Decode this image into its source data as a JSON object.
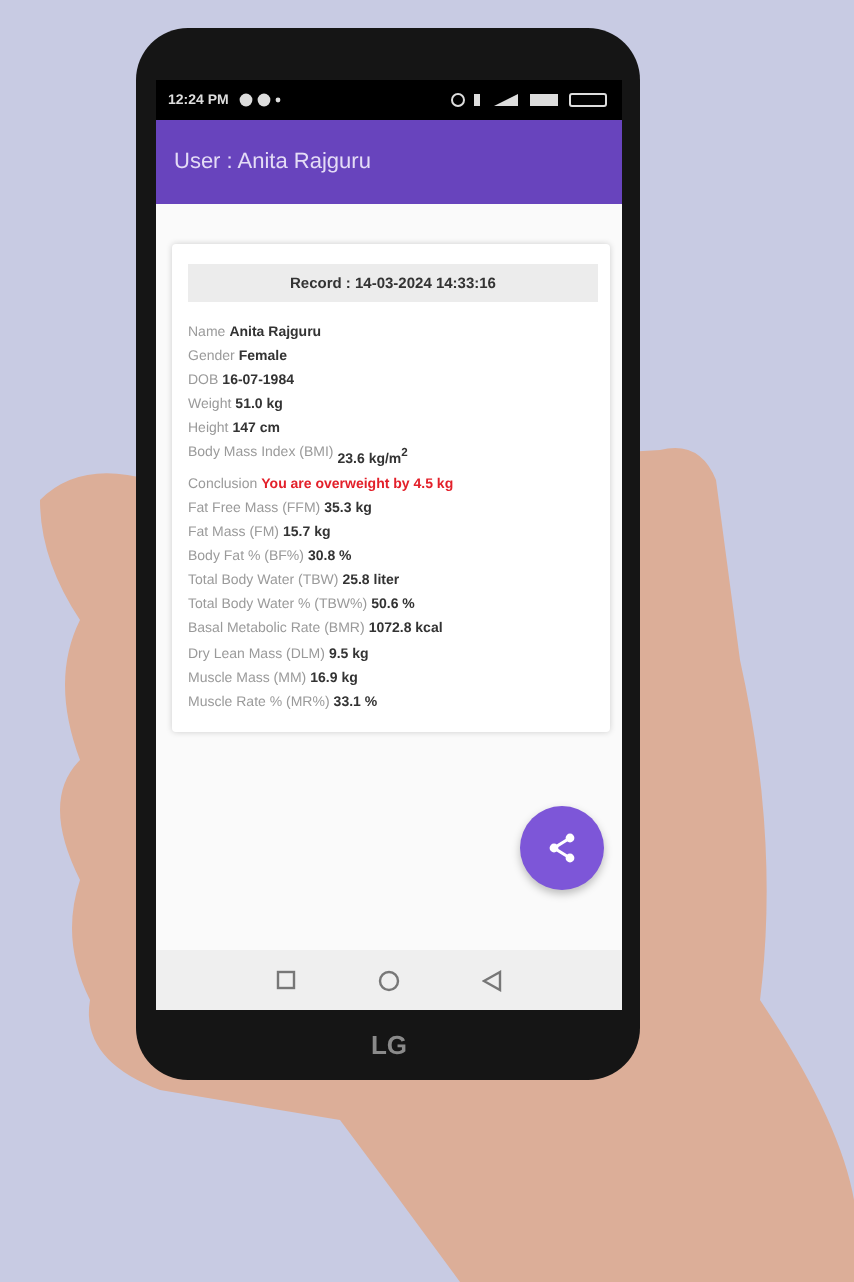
{
  "status_bar": {
    "time": "12:24 PM"
  },
  "app_bar": {
    "title": "User : Anita Rajguru"
  },
  "record": {
    "header": "Record : 14-03-2024 14:33:16",
    "rows": [
      {
        "label": "Name",
        "value": "Anita Rajguru",
        "kind": "normal"
      },
      {
        "label": "Gender",
        "value": "Female",
        "kind": "normal"
      },
      {
        "label": "DOB",
        "value": "16-07-1984",
        "kind": "normal"
      },
      {
        "label": "Weight",
        "value": "51.0 kg",
        "kind": "normal"
      },
      {
        "label": "Height",
        "value": "147 cm",
        "kind": "normal"
      },
      {
        "label": "Body Mass Index (BMI)",
        "value": "23.6 kg/m$^{2}$",
        "kind": "normal"
      },
      {
        "label": "Conclusion",
        "value": "You are overweight by 4.5 kg",
        "kind": "alert"
      },
      {
        "label": "Fat Free Mass (FFM)",
        "value": "35.3 kg",
        "kind": "normal"
      },
      {
        "label": "Fat Mass (FM)",
        "value": "15.7 kg",
        "kind": "normal"
      },
      {
        "label": "Body Fat % (BF%)",
        "value": "30.8 %",
        "kind": "normal"
      },
      {
        "label": "Total Body Water (TBW)",
        "value": "25.8 liter",
        "kind": "normal"
      },
      {
        "label": "Total Body Water % (TBW%)",
        "value": "50.6 %",
        "kind": "normal"
      },
      {
        "label": "Basal Metabolic Rate (BMR)",
        "value": "1072.8 kcal",
        "kind": "normal"
      },
      {
        "label": "Dry Lean Mass (DLM)",
        "value": "9.5 kg",
        "kind": "normal"
      },
      {
        "label": "Muscle Mass (MM)",
        "value": "16.9 kg",
        "kind": "normal"
      },
      {
        "label": "Muscle Rate % (MR%)",
        "value": "33.1 %",
        "kind": "normal"
      }
    ]
  },
  "phone": {
    "brand": "LG"
  }
}
